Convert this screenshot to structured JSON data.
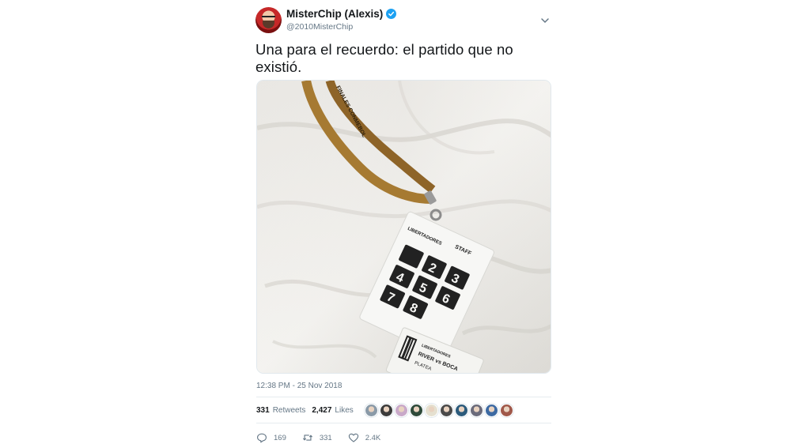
{
  "tweet": {
    "author": {
      "display_name": "MisterChip (Alexis)",
      "handle": "@2010MisterChip",
      "verified": true
    },
    "text": "Una para el recuerdo: el partido que no existió.",
    "media": {
      "lanyard_text": "FINALES CONMEBOL",
      "badge_logo": "LIBERTADORES",
      "badge_role": "STAFF",
      "badge_numbers": [
        "",
        "2",
        "3",
        "4",
        "5",
        "6",
        "7",
        "8"
      ],
      "ticket_logo": "LIBERTADORES",
      "ticket_match": "RIVER vs BOCA",
      "ticket_sector": "PLATEA"
    },
    "timestamp": "12:38 PM - 25 Nov 2018",
    "stats": {
      "retweets_count": "331",
      "retweets_label": "Retweets",
      "likes_count": "2,427",
      "likes_label": "Likes"
    },
    "likers": [
      "#8a9aa8",
      "#3b3b3b",
      "#c9a9c9",
      "#2e4a3a",
      "#e5e0d0",
      "#4a4a4a",
      "#2c5b7c",
      "#6b6b7b",
      "#3d6aa3",
      "#a0584a"
    ],
    "actions": {
      "reply_count": "169",
      "retweet_count": "331",
      "like_count": "2.4K"
    },
    "colors": {
      "verified": "#1da1f2",
      "secondary_text": "#657786",
      "divider": "#e6ecf0"
    },
    "icons": [
      "verified-icon",
      "caret-down-icon",
      "reply-icon",
      "retweet-icon",
      "like-icon"
    ]
  }
}
